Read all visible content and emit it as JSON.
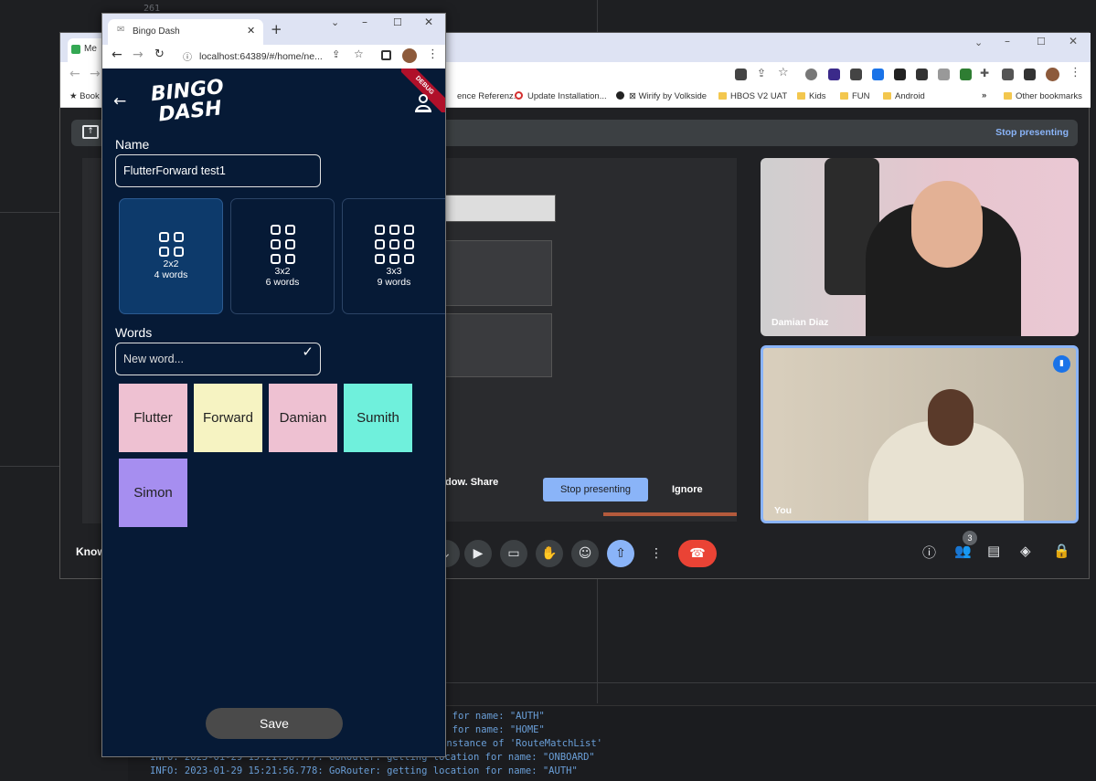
{
  "ide": {
    "line_no": "261"
  },
  "console": {
    "lines": [
      "n for name: \"AUTH\"",
      "n for name: \"HOME\"",
      "instance of 'RouteMatchList'",
      "INFO: 2023-01-29 15:21:56.777: GoRouter: getting location for name: \"ONBOARD\"",
      "INFO: 2023-01-29 15:21:56.778: GoRouter: getting location for name: \"AUTH\""
    ]
  },
  "meet": {
    "tab_label": "Me",
    "bookmarks": [
      {
        "label": "Book"
      },
      {
        "label": "ence Referenz..."
      },
      {
        "label": "Update Installation..."
      },
      {
        "label": "Wirify by Volkside"
      },
      {
        "label": "HBOS V2 UAT"
      },
      {
        "label": "Kids"
      },
      {
        "label": "FUN"
      },
      {
        "label": "Android"
      },
      {
        "label": "»"
      },
      {
        "label": "Other bookmarks"
      }
    ],
    "stop_presenting_top": "Stop presenting",
    "share_text": "dow. Share",
    "stop_presenting_btn": "Stop presenting",
    "ignore_btn": "Ignore",
    "left_caption": "Know",
    "participants": [
      {
        "name": "Damian Diaz"
      },
      {
        "name": "You"
      }
    ],
    "people_count": "3",
    "colors": {
      "accent": "#8ab4f8",
      "end_call": "#ea4335",
      "active_tile_border": "#8ab4f8"
    }
  },
  "browser": {
    "tab_title": "Bingo Dash",
    "url": "localhost:64389/#/home/ne...",
    "debug_banner": "DEBUG"
  },
  "app": {
    "logo_line1": "BINGO",
    "logo_line2": "DASH",
    "name_label": "Name",
    "name_value": "FlutterForward test1",
    "grid_options": [
      {
        "size": "2x2",
        "words": "4 words",
        "cols": 2,
        "rows": 2,
        "selected": true
      },
      {
        "size": "3x2",
        "words": "6 words",
        "cols": 2,
        "rows": 3,
        "selected": false
      },
      {
        "size": "3x3",
        "words": "9 words",
        "cols": 3,
        "rows": 3,
        "selected": false
      }
    ],
    "words_label": "Words",
    "word_placeholder": "New word...",
    "words": [
      {
        "text": "Flutter",
        "color": "#eec1d2"
      },
      {
        "text": "Forward",
        "color": "#f6f3c2"
      },
      {
        "text": "Damian",
        "color": "#eec1d2"
      },
      {
        "text": "Sumith",
        "color": "#6ff0dc"
      },
      {
        "text": "Simon",
        "color": "#a68ef0"
      }
    ],
    "save_label": "Save",
    "colors": {
      "background": "#061a36",
      "selected_card": "#0d3a6b"
    }
  }
}
